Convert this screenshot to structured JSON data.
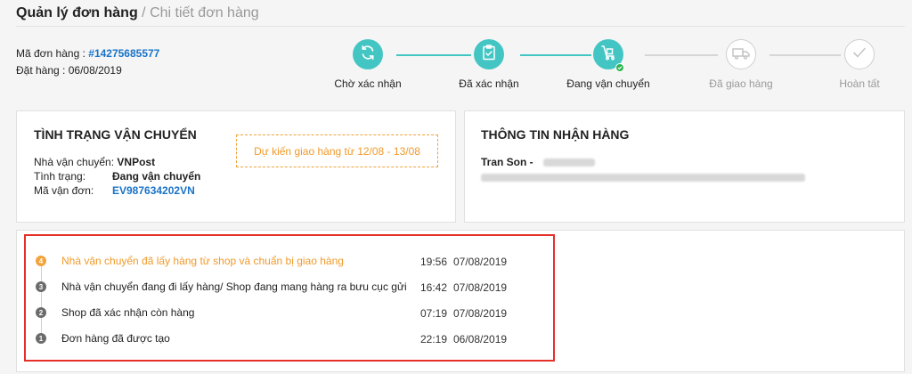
{
  "breadcrumb": {
    "main": "Quản lý đơn hàng",
    "sep": " / ",
    "sub": "Chi tiết đơn hàng"
  },
  "order": {
    "id_label": "Mã đơn hàng : ",
    "id_value": "#14275685577",
    "date_label": "Đặt hàng : ",
    "date_value": "06/08/2019"
  },
  "steps": [
    {
      "label": "Chờ xác nhận",
      "icon": "refresh-icon",
      "state": "done"
    },
    {
      "label": "Đã xác nhận",
      "icon": "clipboard-check-icon",
      "state": "done"
    },
    {
      "label": "Đang vận chuyển",
      "icon": "delivery-cart-icon",
      "state": "current"
    },
    {
      "label": "Đã giao hàng",
      "icon": "truck-icon",
      "state": "pending"
    },
    {
      "label": "Hoàn tất",
      "icon": "check-icon",
      "state": "pending"
    }
  ],
  "shipping": {
    "title": "TÌNH TRẠNG VẬN CHUYỂN",
    "carrier_label": "Nhà vận chuyển: ",
    "carrier_value": "VNPost",
    "status_label": "Tình trạng:",
    "status_value": "Đang vận chuyển",
    "tracking_label": "Mã vận đơn:",
    "tracking_value": "EV987634202VN",
    "eta": "Dự kiến giao hàng từ 12/08 - 13/08"
  },
  "receiver": {
    "title": "THÔNG TIN NHẬN HÀNG",
    "name": "Tran Son - "
  },
  "timeline": [
    {
      "num": "4",
      "text": "Nhà vận chuyển đã lấy hàng từ shop và chuẩn bị giao hàng",
      "time": "19:56",
      "date": "07/08/2019",
      "latest": true
    },
    {
      "num": "3",
      "text": "Nhà vận chuyển đang đi lấy hàng/ Shop đang mang hàng ra bưu cục gửi",
      "time": "16:42",
      "date": "07/08/2019",
      "latest": false
    },
    {
      "num": "2",
      "text": "Shop đã xác nhận còn hàng",
      "time": "07:19",
      "date": "07/08/2019",
      "latest": false
    },
    {
      "num": "1",
      "text": "Đơn hàng đã được tạo",
      "time": "22:19",
      "date": "06/08/2019",
      "latest": false
    }
  ],
  "colors": {
    "accent": "#43c6c3",
    "link": "#1a73c9",
    "orange": "#f09a2a",
    "highlight": "#e5302a",
    "done_badge": "#2ab24f"
  }
}
